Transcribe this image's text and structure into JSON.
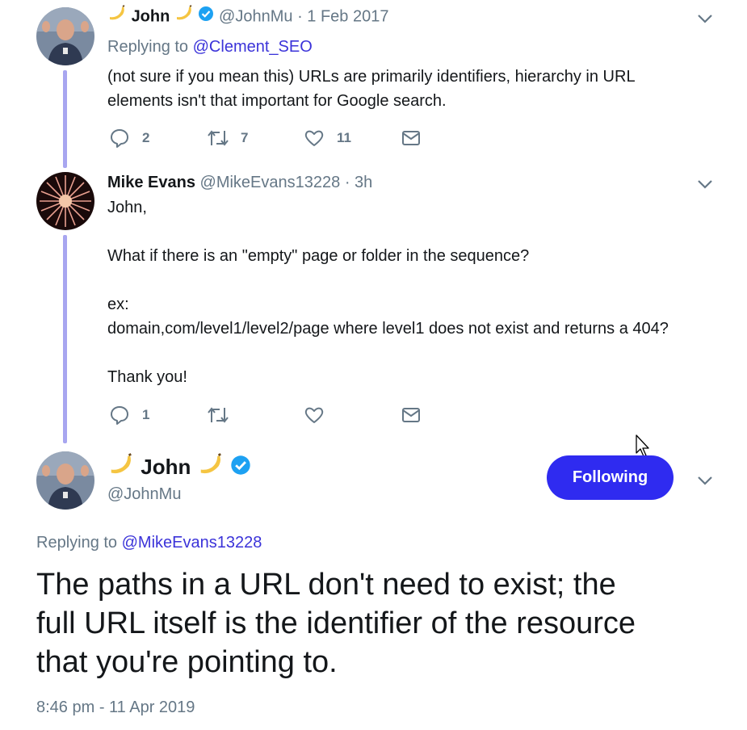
{
  "tweet1": {
    "display_name": "John",
    "handle": "@JohnMu",
    "date": "· 1 Feb 2017",
    "replying_prefix": "Replying to",
    "replying_to": "@Clement_SEO",
    "text_line1": "(not sure if you mean this) URLs are primarily identifiers, hierarchy in URL",
    "text_line2": "elements isn't that important for Google search.",
    "replies": "2",
    "retweets": "7",
    "likes": "11"
  },
  "tweet2": {
    "display_name": "Mike Evans",
    "handle": "@MikeEvans13228",
    "date": "· 3h",
    "lines": [
      "John,",
      "What if there is an \"empty\" page or folder in the sequence?",
      "ex:",
      "domain,com/level1/level2/page where level1 does not exist and returns a 404?",
      "Thank you!"
    ],
    "replies": "1"
  },
  "main_tweet": {
    "display_name": "John",
    "handle": "@JohnMu",
    "follow_label": "Following",
    "replying_prefix": "Replying to",
    "replying_to": "@MikeEvans13228",
    "text_line1": "The paths in a URL don't need to exist; the",
    "text_line2": "full URL itself is the identifier of the resource",
    "text_line3": "that you're pointing to.",
    "timestamp": "8:46 pm - 11 Apr 2019"
  },
  "colors": {
    "accent": "#2f2bf0",
    "link": "#3b33d9",
    "muted": "#657786",
    "thread_line": "#a8a6f0",
    "verified": "#1da1f2"
  },
  "icons": [
    "banana-icon",
    "verified-icon",
    "reply-icon",
    "retweet-icon",
    "like-icon",
    "dm-icon",
    "chevron-down-icon",
    "cursor-icon"
  ]
}
